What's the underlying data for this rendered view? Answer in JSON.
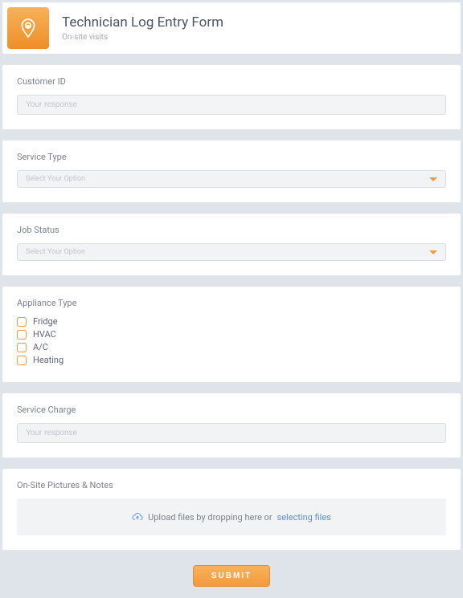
{
  "header": {
    "title": "Technician Log Entry Form",
    "subtitle": "On-site visits"
  },
  "customer_id": {
    "label": "Customer ID",
    "placeholder": "Your response",
    "value": ""
  },
  "service_type": {
    "label": "Service Type",
    "placeholder": "Select Your Option"
  },
  "job_status": {
    "label": "Job Status",
    "placeholder": "Select Your Option"
  },
  "appliance_type": {
    "label": "Appliance Type",
    "options": [
      "Fridge",
      "HVAC",
      "A/C",
      "Heating"
    ]
  },
  "service_charge": {
    "label": "Service Charge",
    "placeholder": "Your response",
    "value": ""
  },
  "upload": {
    "label": "On-Site Pictures & Notes",
    "text_prefix": "Upload files by dropping here or",
    "link_text": "selecting files"
  },
  "submit_label": "SUBMIT"
}
